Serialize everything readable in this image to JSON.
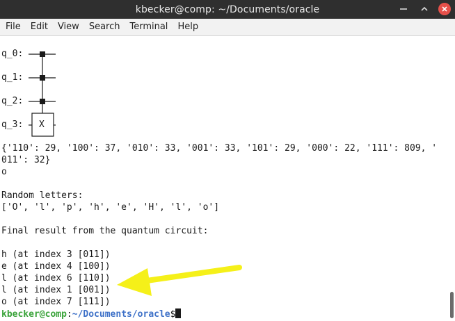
{
  "window": {
    "title": "kbecker@comp: ~/Documents/oracle"
  },
  "menu": {
    "items": [
      "File",
      "Edit",
      "View",
      "Search",
      "Terminal",
      "Help"
    ]
  },
  "circuit": {
    "qubits": [
      "q_0:",
      "q_1:",
      "q_2:",
      "q_3:"
    ],
    "target_gate": "X"
  },
  "output": {
    "counts_line1": "{'110': 29, '100': 37, '010': 33, '001': 33, '101': 29, '000': 22, '111': 809, '",
    "counts_line2": "011': 32}",
    "single_char": "o",
    "blank1": "",
    "random_heading": "Random letters:",
    "random_list": "['O', 'l', 'p', 'h', 'e', 'H', 'l', 'o']",
    "blank2": "",
    "final_heading": "Final result from the quantum circuit:",
    "blank3": "",
    "results": [
      "h (at index 3 [011])",
      "e (at index 4 [100])",
      "l (at index 6 [110])",
      "l (at index 1 [001])",
      "o (at index 7 [111])"
    ]
  },
  "prompt": {
    "user": "kbecker@comp",
    "sep": ":",
    "path": "~/Documents/oracle",
    "symbol": "$"
  },
  "colors": {
    "arrow": "#f5f019",
    "prompt_user": "#3aa33a",
    "prompt_path": "#3e71c8"
  }
}
